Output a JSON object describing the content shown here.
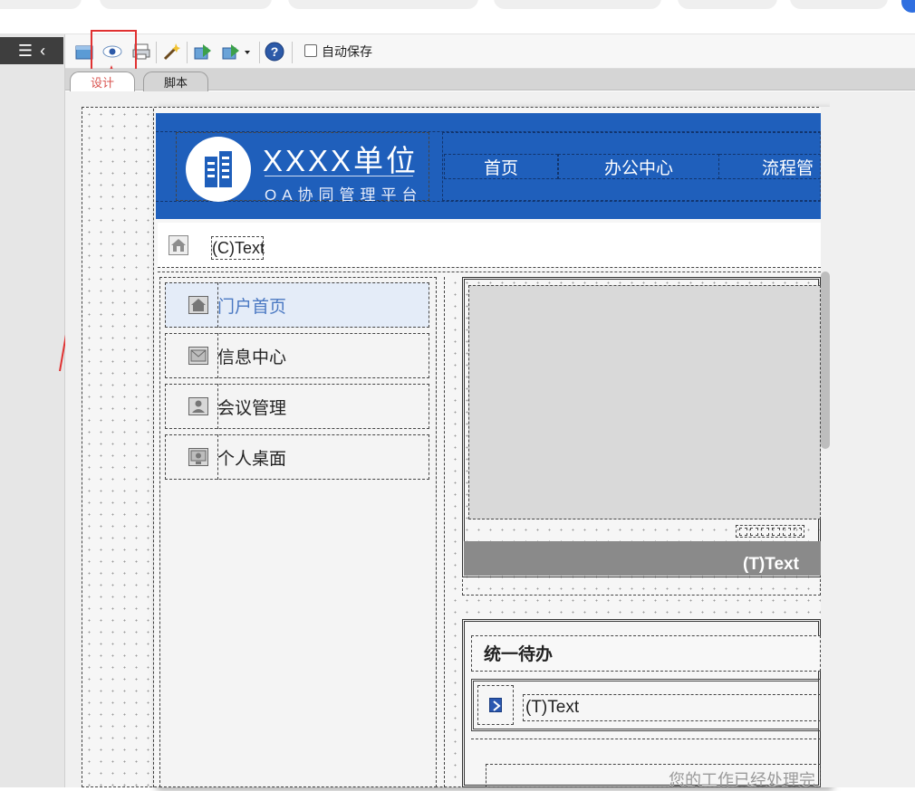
{
  "toolbar": {
    "autosave_label": "自动保存",
    "autosave_checked": false
  },
  "tabs": [
    {
      "label": "设计",
      "active": true
    },
    {
      "label": "脚本",
      "active": false
    }
  ],
  "header": {
    "logo_title": "XXXX单位",
    "logo_subtitle": "OA协同管理平台",
    "nav": [
      "首页",
      "办公中心",
      "流程管"
    ]
  },
  "breadcrumb": {
    "text": "(C)Text"
  },
  "side_menu": [
    {
      "label": "门户首页",
      "icon": "home-icon",
      "active": true
    },
    {
      "label": "信息中心",
      "icon": "mail-icon",
      "active": false
    },
    {
      "label": "会议管理",
      "icon": "person-icon",
      "active": false
    },
    {
      "label": "个人桌面",
      "icon": "monitor-icon",
      "active": false
    }
  ],
  "banner": {
    "caption": "(T)Text"
  },
  "todo": {
    "title": "统一待办",
    "row_text": "(T)Text",
    "done_text": "您的工作已经处理完"
  },
  "colors": {
    "header_blue": "#1f5fbb",
    "annotation_red": "#e03131",
    "menu_active": "#e4ecf8",
    "menu_active_text": "#4a78c2"
  }
}
